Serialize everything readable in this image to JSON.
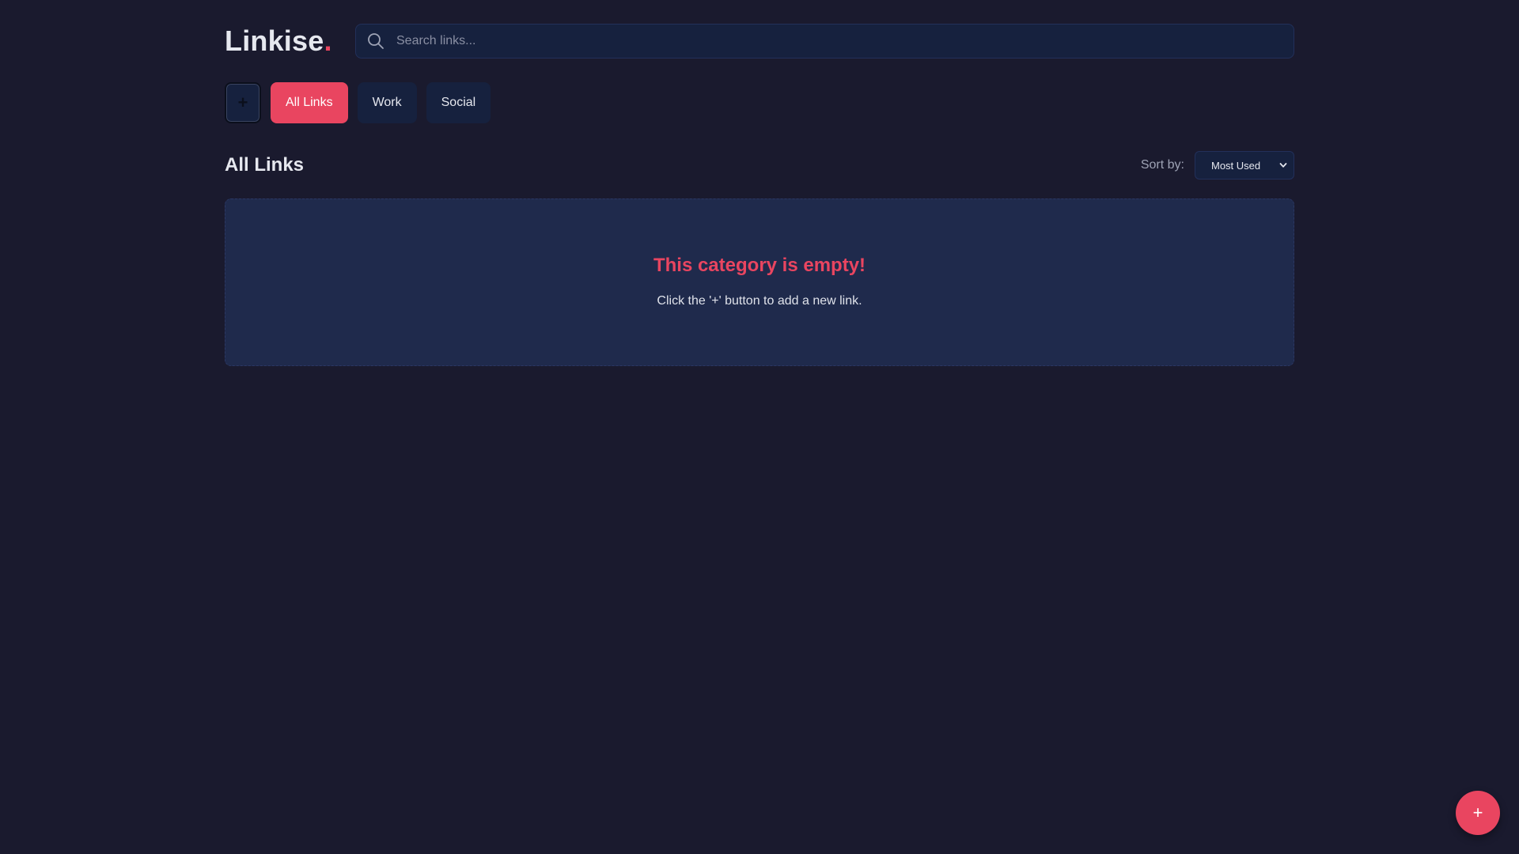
{
  "app": {
    "logo_text": "Linkise",
    "logo_dot": "."
  },
  "search": {
    "placeholder": "Search links...",
    "value": "",
    "icon": "search-icon"
  },
  "categories": {
    "add_label": "+",
    "items": [
      {
        "label": "All Links",
        "active": true
      },
      {
        "label": "Work",
        "active": false
      },
      {
        "label": "Social",
        "active": false
      }
    ]
  },
  "section": {
    "title": "All Links",
    "sort_label": "Sort by:",
    "sort_value": "Most Used"
  },
  "empty_state": {
    "title": "This category is empty!",
    "message": "Click the '+' button to add a new link."
  },
  "fab": {
    "label": "+"
  },
  "colors": {
    "background": "#1a1a2e",
    "surface": "#16213e",
    "card": "#1f2a4c",
    "accent": "#e94560",
    "text": "#e6e8ef"
  }
}
